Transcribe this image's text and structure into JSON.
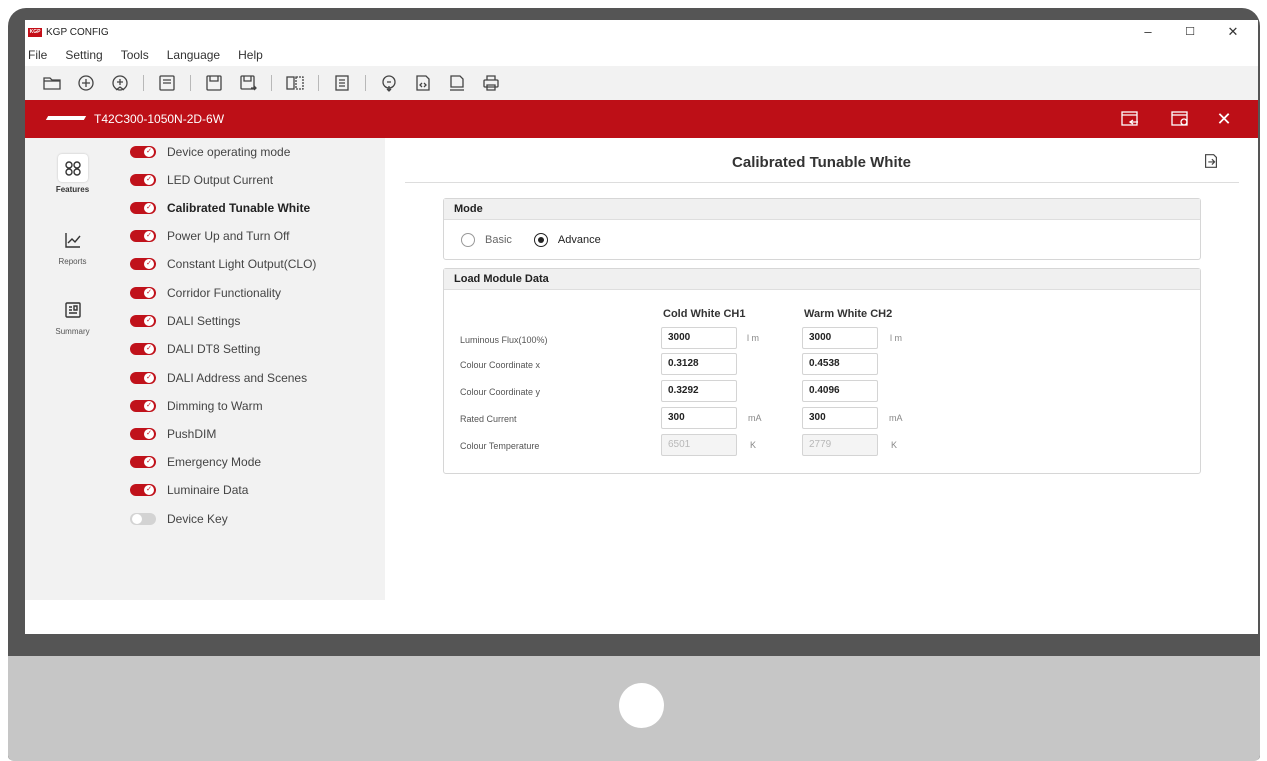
{
  "window": {
    "title": "KGP CONFIG",
    "logo_text": "KGP",
    "controls": {
      "minimize": "–",
      "maximize": "☐",
      "close": "✕"
    }
  },
  "menu": [
    "File",
    "Setting",
    "Tools",
    "Language",
    "Help"
  ],
  "toolbar_icons": [
    "open-folder-icon",
    "add-icon",
    "add-device-icon",
    "read-icon",
    "save-icon",
    "save-as-icon",
    "compare-icon",
    "list-icon",
    "sync-icon",
    "code-export-icon",
    "html-export-icon",
    "print-icon"
  ],
  "device": {
    "name": "T42C300-1050N-2D-6W",
    "close_label": "✕"
  },
  "rail": [
    {
      "label": "Features",
      "icon": "features-icon",
      "active": true
    },
    {
      "label": "Reports",
      "icon": "reports-icon",
      "active": false
    },
    {
      "label": "Summary",
      "icon": "summary-icon",
      "active": false
    }
  ],
  "features": [
    {
      "label": "Device operating mode",
      "enabled": true
    },
    {
      "label": "LED Output Current",
      "enabled": true
    },
    {
      "label": "Calibrated Tunable White",
      "enabled": true,
      "selected": true
    },
    {
      "label": "Power Up and Turn Off",
      "enabled": true
    },
    {
      "label": "Constant Light Output(CLO)",
      "enabled": true
    },
    {
      "label": "Corridor Functionality",
      "enabled": true
    },
    {
      "label": "DALI Settings",
      "enabled": true
    },
    {
      "label": "DALI DT8 Setting",
      "enabled": true
    },
    {
      "label": "DALI Address and Scenes",
      "enabled": true
    },
    {
      "label": "Dimming to Warm",
      "enabled": true
    },
    {
      "label": "PushDIM",
      "enabled": true
    },
    {
      "label": "Emergency Mode",
      "enabled": true
    },
    {
      "label": "Luminaire Data",
      "enabled": true
    },
    {
      "label": "Device Key",
      "enabled": false
    }
  ],
  "page": {
    "title": "Calibrated Tunable White",
    "mode_panel": {
      "title": "Mode",
      "options": [
        "Basic",
        "Advance"
      ],
      "selected": "Advance"
    },
    "load_panel": {
      "title": "Load Module Data",
      "columns": [
        "Cold White CH1",
        "Warm White CH2"
      ],
      "rows": [
        {
          "label": "Luminous Flux(100%)",
          "ch1": "3000",
          "ch2": "3000",
          "unit": "l m",
          "disabled": false
        },
        {
          "label": "Colour Coordinate x",
          "ch1": "0.3128",
          "ch2": "0.4538",
          "unit": "",
          "disabled": false
        },
        {
          "label": "Colour Coordinate y",
          "ch1": "0.3292",
          "ch2": "0.4096",
          "unit": "",
          "disabled": false
        },
        {
          "label": "Rated Current",
          "ch1": "300",
          "ch2": "300",
          "unit": "mA",
          "disabled": false
        },
        {
          "label": "Colour Temperature",
          "ch1": "6501",
          "ch2": "2779",
          "unit": "K",
          "disabled": true
        }
      ]
    }
  },
  "colors": {
    "brand_red": "#bd0f17",
    "toggle_on": "#c0121b",
    "toggle_off": "#d3d3d3",
    "bezel": "#555555"
  }
}
